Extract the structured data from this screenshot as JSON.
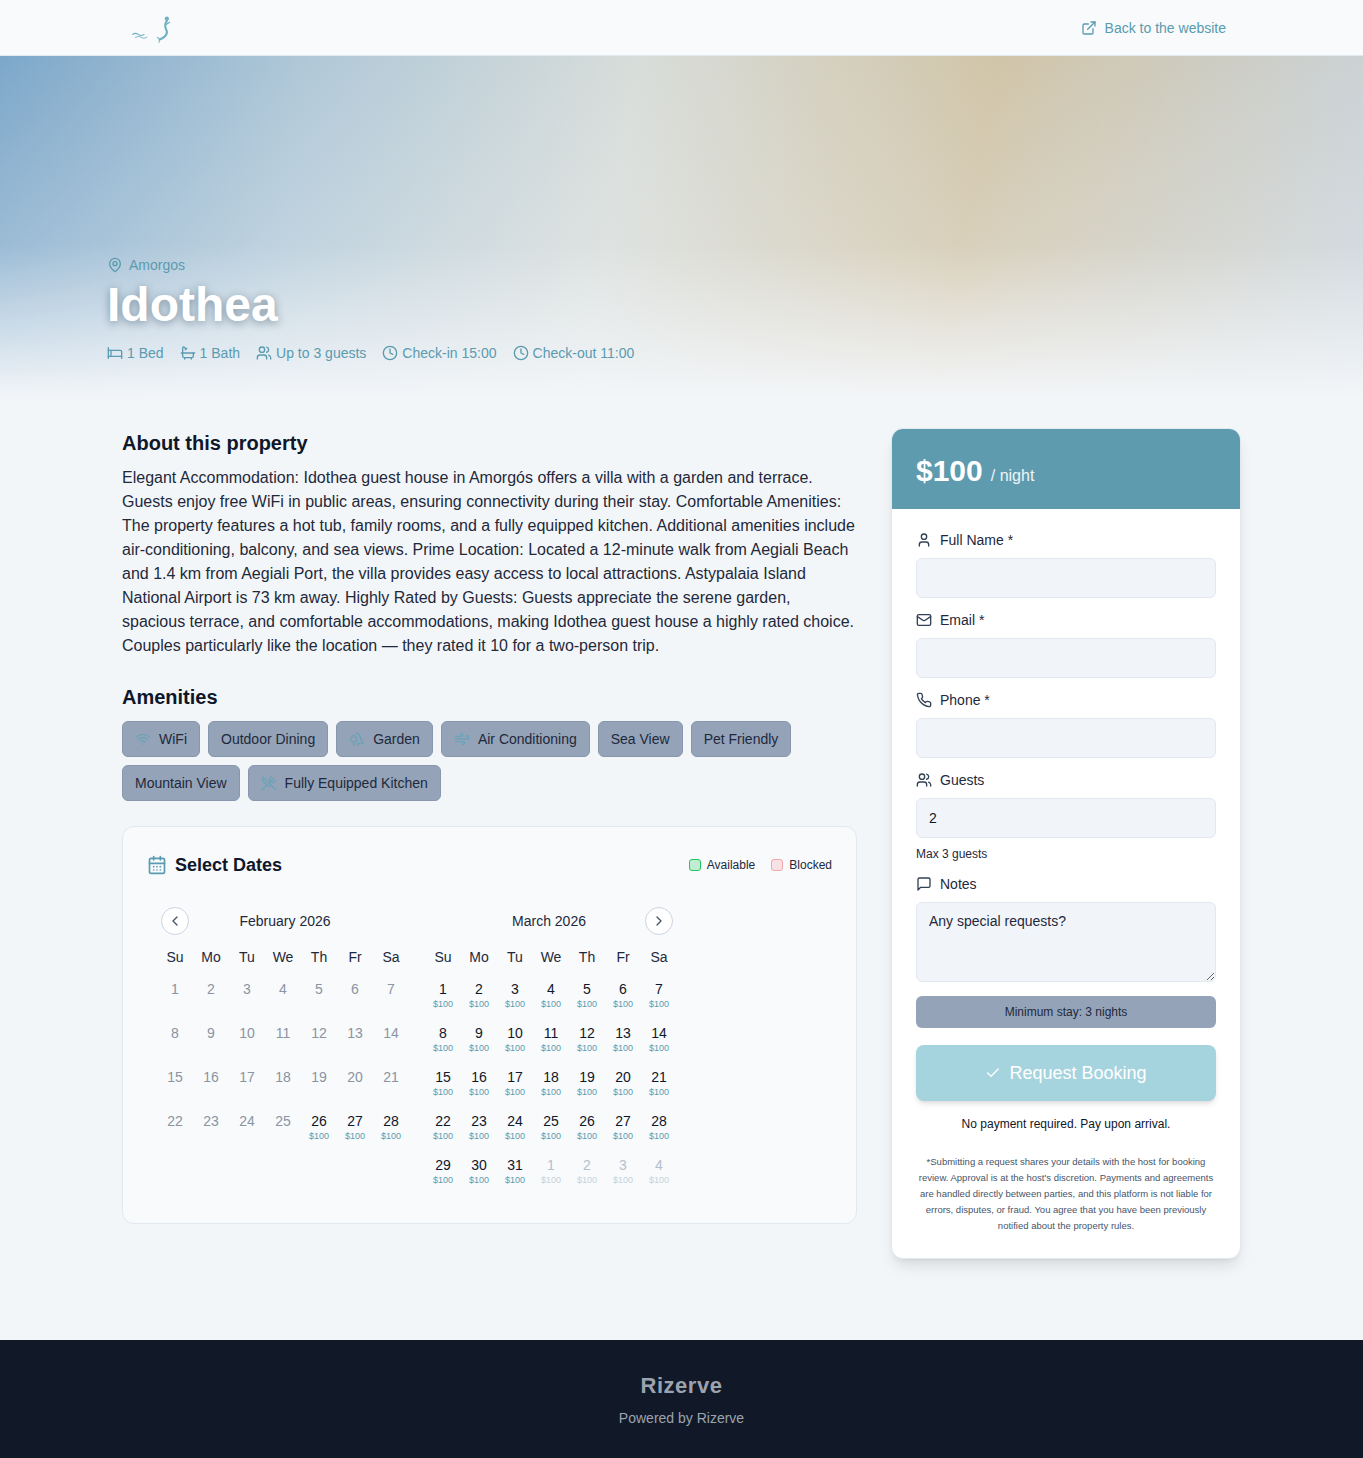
{
  "header": {
    "back_link": "Back to the website"
  },
  "hero": {
    "location": "Amorgos",
    "title": "Idothea",
    "features": [
      {
        "label": "1 Bed"
      },
      {
        "label": "1 Bath"
      },
      {
        "label": "Up to 3 guests"
      },
      {
        "label": "Check-in 15:00"
      },
      {
        "label": "Check-out 11:00"
      }
    ]
  },
  "about": {
    "heading": "About this property",
    "text": "Elegant Accommodation: Idothea guest house in Amorgós offers a villa with a garden and terrace. Guests enjoy free WiFi in public areas, ensuring connectivity during their stay. Comfortable Amenities: The property features a hot tub, family rooms, and a fully equipped kitchen. Additional amenities include air-conditioning, balcony, and sea views. Prime Location: Located a 12-minute walk from Aegiali Beach and 1.4 km from Aegiali Port, the villa provides easy access to local attractions. Astypalaia Island National Airport is 73 km away. Highly Rated by Guests: Guests appreciate the serene garden, spacious terrace, and comfortable accommodations, making Idothea guest house a highly rated choice. Couples particularly like the location — they rated it 10 for a two-person trip."
  },
  "amenities": {
    "heading": "Amenities",
    "items": [
      {
        "label": "WiFi",
        "kind": "icon"
      },
      {
        "label": "Outdoor Dining",
        "kind": "text"
      },
      {
        "label": "Garden",
        "kind": "icon"
      },
      {
        "label": "Air Conditioning",
        "kind": "icon"
      },
      {
        "label": "Sea View",
        "kind": "text"
      },
      {
        "label": "Pet Friendly",
        "kind": "text"
      },
      {
        "label": "Mountain View",
        "kind": "text"
      },
      {
        "label": "Fully Equipped Kitchen",
        "kind": "icon"
      }
    ]
  },
  "calendar": {
    "title": "Select Dates",
    "legend": [
      {
        "label": "Available",
        "color": "#22c55e"
      },
      {
        "label": "Blocked",
        "color": "#f4a5a5"
      }
    ],
    "weekdays": [
      "Su",
      "Mo",
      "Tu",
      "We",
      "Th",
      "Fr",
      "Sa"
    ],
    "months": [
      {
        "name": "February 2026",
        "days": [
          {
            "day": "1",
            "kind": "past"
          },
          {
            "day": "2",
            "kind": "past"
          },
          {
            "day": "3",
            "kind": "past"
          },
          {
            "day": "4",
            "kind": "past"
          },
          {
            "day": "5",
            "kind": "past"
          },
          {
            "day": "6",
            "kind": "past"
          },
          {
            "day": "7",
            "kind": "past"
          },
          {
            "day": "8",
            "kind": "past"
          },
          {
            "day": "9",
            "kind": "past"
          },
          {
            "day": "10",
            "kind": "past"
          },
          {
            "day": "11",
            "kind": "past"
          },
          {
            "day": "12",
            "kind": "past"
          },
          {
            "day": "13",
            "kind": "past"
          },
          {
            "day": "14",
            "kind": "past"
          },
          {
            "day": "15",
            "kind": "past"
          },
          {
            "day": "16",
            "kind": "past"
          },
          {
            "day": "17",
            "kind": "past"
          },
          {
            "day": "18",
            "kind": "past"
          },
          {
            "day": "19",
            "kind": "past"
          },
          {
            "day": "20",
            "kind": "past"
          },
          {
            "day": "21",
            "kind": "past"
          },
          {
            "day": "22",
            "kind": "past"
          },
          {
            "day": "23",
            "kind": "past"
          },
          {
            "day": "24",
            "kind": "past"
          },
          {
            "day": "25",
            "kind": "past"
          },
          {
            "day": "26",
            "kind": "available",
            "price": "$100"
          },
          {
            "day": "27",
            "kind": "available",
            "price": "$100"
          },
          {
            "day": "28",
            "kind": "available",
            "price": "$100"
          }
        ]
      },
      {
        "name": "March 2026",
        "days": [
          {
            "day": "1",
            "kind": "available",
            "price": "$100"
          },
          {
            "day": "2",
            "kind": "available",
            "price": "$100"
          },
          {
            "day": "3",
            "kind": "available",
            "price": "$100"
          },
          {
            "day": "4",
            "kind": "available",
            "price": "$100"
          },
          {
            "day": "5",
            "kind": "available",
            "price": "$100"
          },
          {
            "day": "6",
            "kind": "available",
            "price": "$100"
          },
          {
            "day": "7",
            "kind": "available",
            "price": "$100"
          },
          {
            "day": "8",
            "kind": "available",
            "price": "$100"
          },
          {
            "day": "9",
            "kind": "available",
            "price": "$100"
          },
          {
            "day": "10",
            "kind": "available",
            "price": "$100"
          },
          {
            "day": "11",
            "kind": "available",
            "price": "$100"
          },
          {
            "day": "12",
            "kind": "available",
            "price": "$100"
          },
          {
            "day": "13",
            "kind": "available",
            "price": "$100"
          },
          {
            "day": "14",
            "kind": "available",
            "price": "$100"
          },
          {
            "day": "15",
            "kind": "available",
            "price": "$100"
          },
          {
            "day": "16",
            "kind": "available",
            "price": "$100"
          },
          {
            "day": "17",
            "kind": "available",
            "price": "$100"
          },
          {
            "day": "18",
            "kind": "available",
            "price": "$100"
          },
          {
            "day": "19",
            "kind": "available",
            "price": "$100"
          },
          {
            "day": "20",
            "kind": "available",
            "price": "$100"
          },
          {
            "day": "21",
            "kind": "available",
            "price": "$100"
          },
          {
            "day": "22",
            "kind": "available",
            "price": "$100"
          },
          {
            "day": "23",
            "kind": "available",
            "price": "$100"
          },
          {
            "day": "24",
            "kind": "available",
            "price": "$100"
          },
          {
            "day": "25",
            "kind": "available",
            "price": "$100"
          },
          {
            "day": "26",
            "kind": "available",
            "price": "$100"
          },
          {
            "day": "27",
            "kind": "available",
            "price": "$100"
          },
          {
            "day": "28",
            "kind": "available",
            "price": "$100"
          },
          {
            "day": "29",
            "kind": "available",
            "price": "$100"
          },
          {
            "day": "30",
            "kind": "available",
            "price": "$100"
          },
          {
            "day": "31",
            "kind": "available",
            "price": "$100"
          },
          {
            "day": "1",
            "kind": "outside",
            "price": "$100"
          },
          {
            "day": "2",
            "kind": "outside",
            "price": "$100"
          },
          {
            "day": "3",
            "kind": "outside",
            "price": "$100"
          },
          {
            "day": "4",
            "kind": "outside",
            "price": "$100"
          }
        ]
      }
    ]
  },
  "booking": {
    "price": "$100",
    "unit": "/ night",
    "fields": [
      {
        "label": "Full Name *",
        "kind": "input"
      },
      {
        "label": "Email *",
        "kind": "input"
      },
      {
        "label": "Phone *",
        "kind": "input"
      },
      {
        "label": "Guests",
        "kind": "input",
        "value": "2",
        "hint": "Max 3 guests"
      },
      {
        "label": "Notes",
        "kind": "textarea",
        "placeholder": "Any special requests?"
      }
    ],
    "min_stay": "Minimum stay: 3 nights",
    "submit": {
      "label": "Request Booking",
      "disabled": true
    },
    "payment_note": "No payment required. Pay upon arrival.",
    "disclaimer": "*Submitting a request shares your details with the host for booking review. Approval is at the host's discretion. Payments and agreements are handled directly between parties, and this platform is not liable for errors, disputes, or fraud. You agree that you have been previously notified about the property rules."
  },
  "footer": {
    "brand": "Rizerve",
    "powered": "Powered by Rizerve"
  }
}
